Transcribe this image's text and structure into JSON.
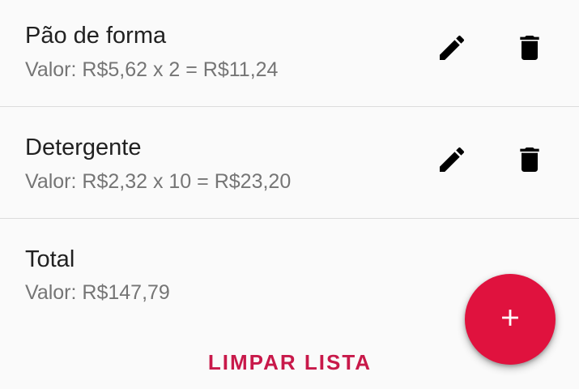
{
  "items": [
    {
      "name": "Pão de forma",
      "value": "Valor: R$5,62 x 2 = R$11,24",
      "edit_icon": "pencil-icon",
      "delete_icon": "trash-icon"
    },
    {
      "name": "Detergente",
      "value": "Valor: R$2,32 x 10 = R$23,20",
      "edit_icon": "pencil-icon",
      "delete_icon": "trash-icon"
    }
  ],
  "total": {
    "label": "Total",
    "value": "Valor: R$147,79"
  },
  "actions": {
    "clear_label": "LIMPAR LISTA",
    "fab_icon": "plus-icon"
  },
  "colors": {
    "accent": "#e0123e",
    "clear_text": "#c8194a",
    "primary_text": "#212121",
    "secondary_text": "#757575",
    "background": "#fafafa",
    "divider": "#dcdcdc"
  }
}
